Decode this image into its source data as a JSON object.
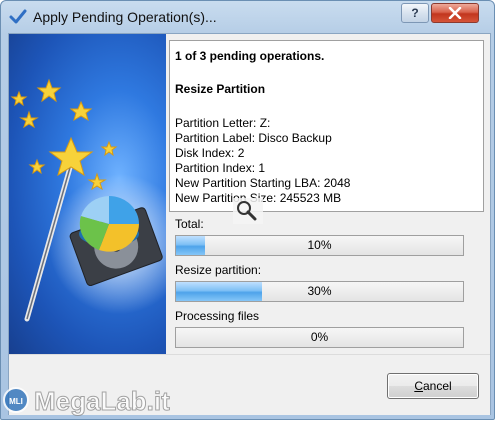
{
  "window": {
    "title": "Apply Pending Operation(s)...",
    "help_label": "?",
    "close_label": "X"
  },
  "info": {
    "heading": "1 of 3 pending operations.",
    "operation": "Resize Partition",
    "details": [
      "Partition Letter: Z:",
      "Partition Label: Disco Backup",
      "Disk Index: 2",
      "Partition Index: 1",
      "New Partition Starting LBA: 2048",
      "New Partition Size: 245523 MB"
    ]
  },
  "progress": {
    "total": {
      "label": "Total:",
      "value_text": "10%",
      "fraction": 0.1
    },
    "resize": {
      "label": "Resize partition:",
      "value_text": "30%",
      "fraction": 0.3
    },
    "files": {
      "label": "Processing files",
      "value_text": "0%",
      "fraction": 0.0
    }
  },
  "buttons": {
    "cancel_prefix": "",
    "cancel_mnemonic": "C",
    "cancel_suffix": "ancel"
  },
  "watermark": {
    "text": "MegaLab.it",
    "badge": "MLI"
  },
  "colors": {
    "progress_fill": "#4ea3ea",
    "art_blue": "#2f79e0",
    "close_red": "#c2361e"
  }
}
